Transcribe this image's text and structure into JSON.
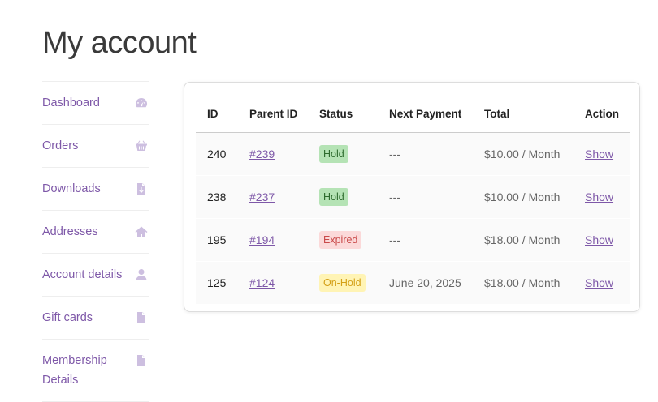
{
  "page": {
    "title": "My account"
  },
  "sidebar": {
    "items": [
      {
        "label": "Dashboard",
        "icon": "dashboard-icon"
      },
      {
        "label": "Orders",
        "icon": "basket-icon"
      },
      {
        "label": "Downloads",
        "icon": "file-download-icon"
      },
      {
        "label": "Addresses",
        "icon": "home-icon"
      },
      {
        "label": "Account details",
        "icon": "user-icon"
      },
      {
        "label": "Gift cards",
        "icon": "document-icon"
      },
      {
        "label": "Membership Details",
        "icon": "document-icon"
      }
    ]
  },
  "subscriptions": {
    "columns": [
      "ID",
      "Parent ID",
      "Status",
      "Next Payment",
      "Total",
      "Action"
    ],
    "rows": [
      {
        "id": "240",
        "parent": "#239",
        "status": "Hold",
        "status_color": "green",
        "next_payment": "---",
        "total": "$10.00 / Month",
        "action": "Show"
      },
      {
        "id": "238",
        "parent": "#237",
        "status": "Hold",
        "status_color": "green",
        "next_payment": "---",
        "total": "$10.00 / Month",
        "action": "Show"
      },
      {
        "id": "195",
        "parent": "#194",
        "status": "Expired",
        "status_color": "red",
        "next_payment": "---",
        "total": "$18.00 / Month",
        "action": "Show"
      },
      {
        "id": "125",
        "parent": "#124",
        "status": "On-Hold",
        "status_color": "yellow",
        "next_payment": "June 20, 2025",
        "total": "$18.00 / Month",
        "action": "Show"
      }
    ]
  },
  "colors": {
    "accent": "#7e58a8",
    "icon": "#cdbfe0",
    "hold_bg": "#b5e3b5",
    "expired_bg": "#fbd9d9",
    "onhold_bg": "#fff4b5"
  }
}
